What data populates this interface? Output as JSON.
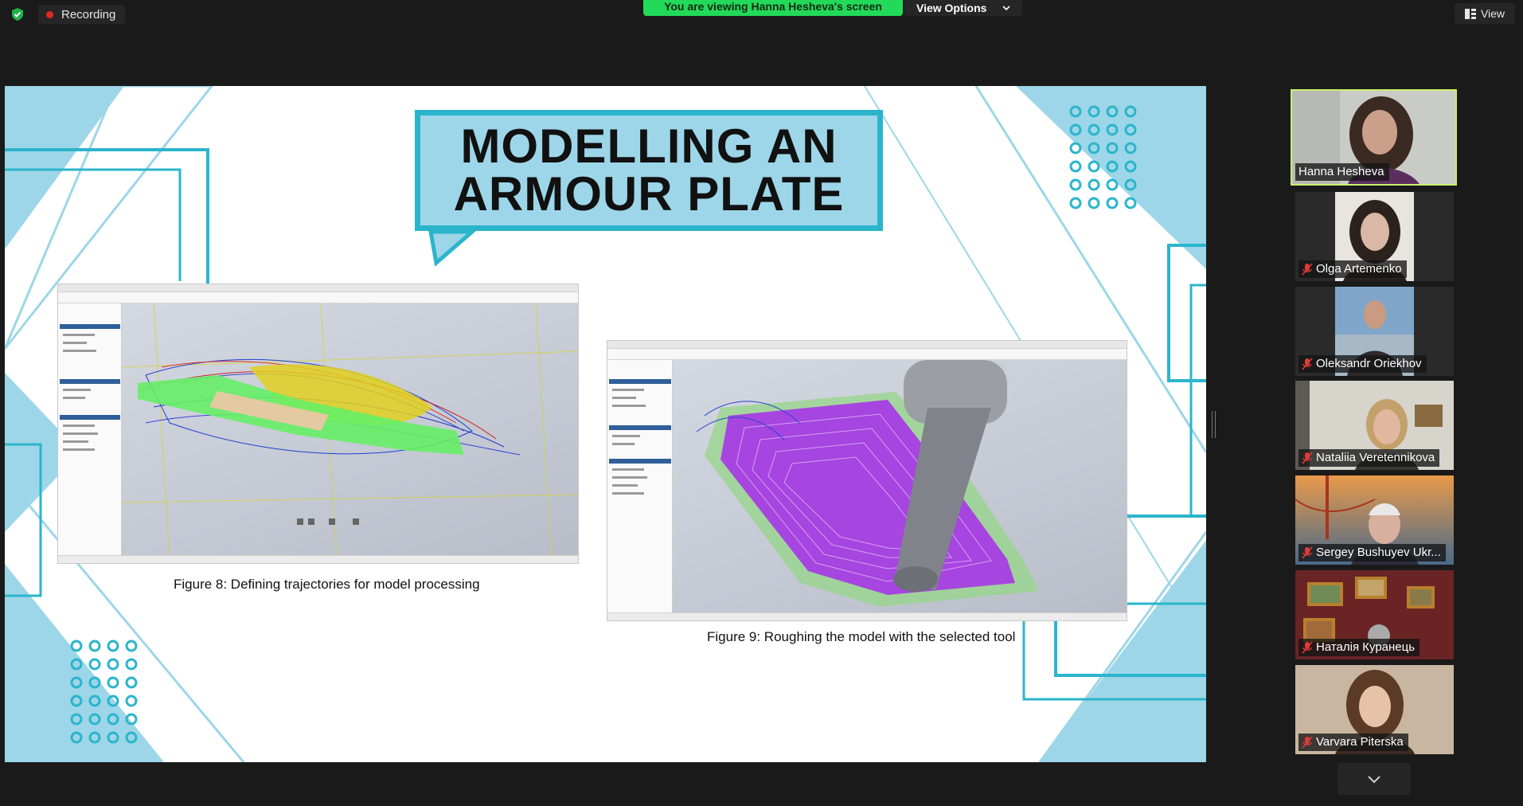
{
  "topbar": {
    "recording_label": "Recording",
    "viewing_banner": "You are viewing Hanna Hesheva's screen",
    "view_options_label": "View Options",
    "view_button_label": "View",
    "icons": [
      "shield-check-icon",
      "record-dot-icon",
      "chevron-down-icon",
      "grid-view-icon"
    ],
    "colors": {
      "banner_green": "#23d959",
      "record_red": "#e02828",
      "shield_green": "#1fb34a"
    }
  },
  "slide": {
    "title_line1": "MODELLING AN",
    "title_line2": "ARMOUR PLATE",
    "figure8_caption": "Figure 8: Defining trajectories for model processing",
    "figure9_caption": "Figure 9: Roughing the model with the selected tool",
    "colors": {
      "accent_light": "#9dd6e8",
      "accent_dark": "#2bb5cc"
    }
  },
  "participants": [
    {
      "name": "Hanna Hesheva",
      "muted": false,
      "active": true
    },
    {
      "name": "Olga Artemenko",
      "muted": true,
      "active": false
    },
    {
      "name": "Oleksandr Oriekhov",
      "muted": true,
      "active": false
    },
    {
      "name": "Nataliia Veretennikova",
      "muted": true,
      "active": false
    },
    {
      "name": "Sergey Bushuyev  Ukr...",
      "muted": true,
      "active": false
    },
    {
      "name": "Наталія Куранець",
      "muted": true,
      "active": false
    },
    {
      "name": "Varvara Piterska",
      "muted": true,
      "active": false
    }
  ],
  "gallery": {
    "scroll_icon": "chevron-down-icon",
    "active_border_color": "#c8f06a"
  }
}
